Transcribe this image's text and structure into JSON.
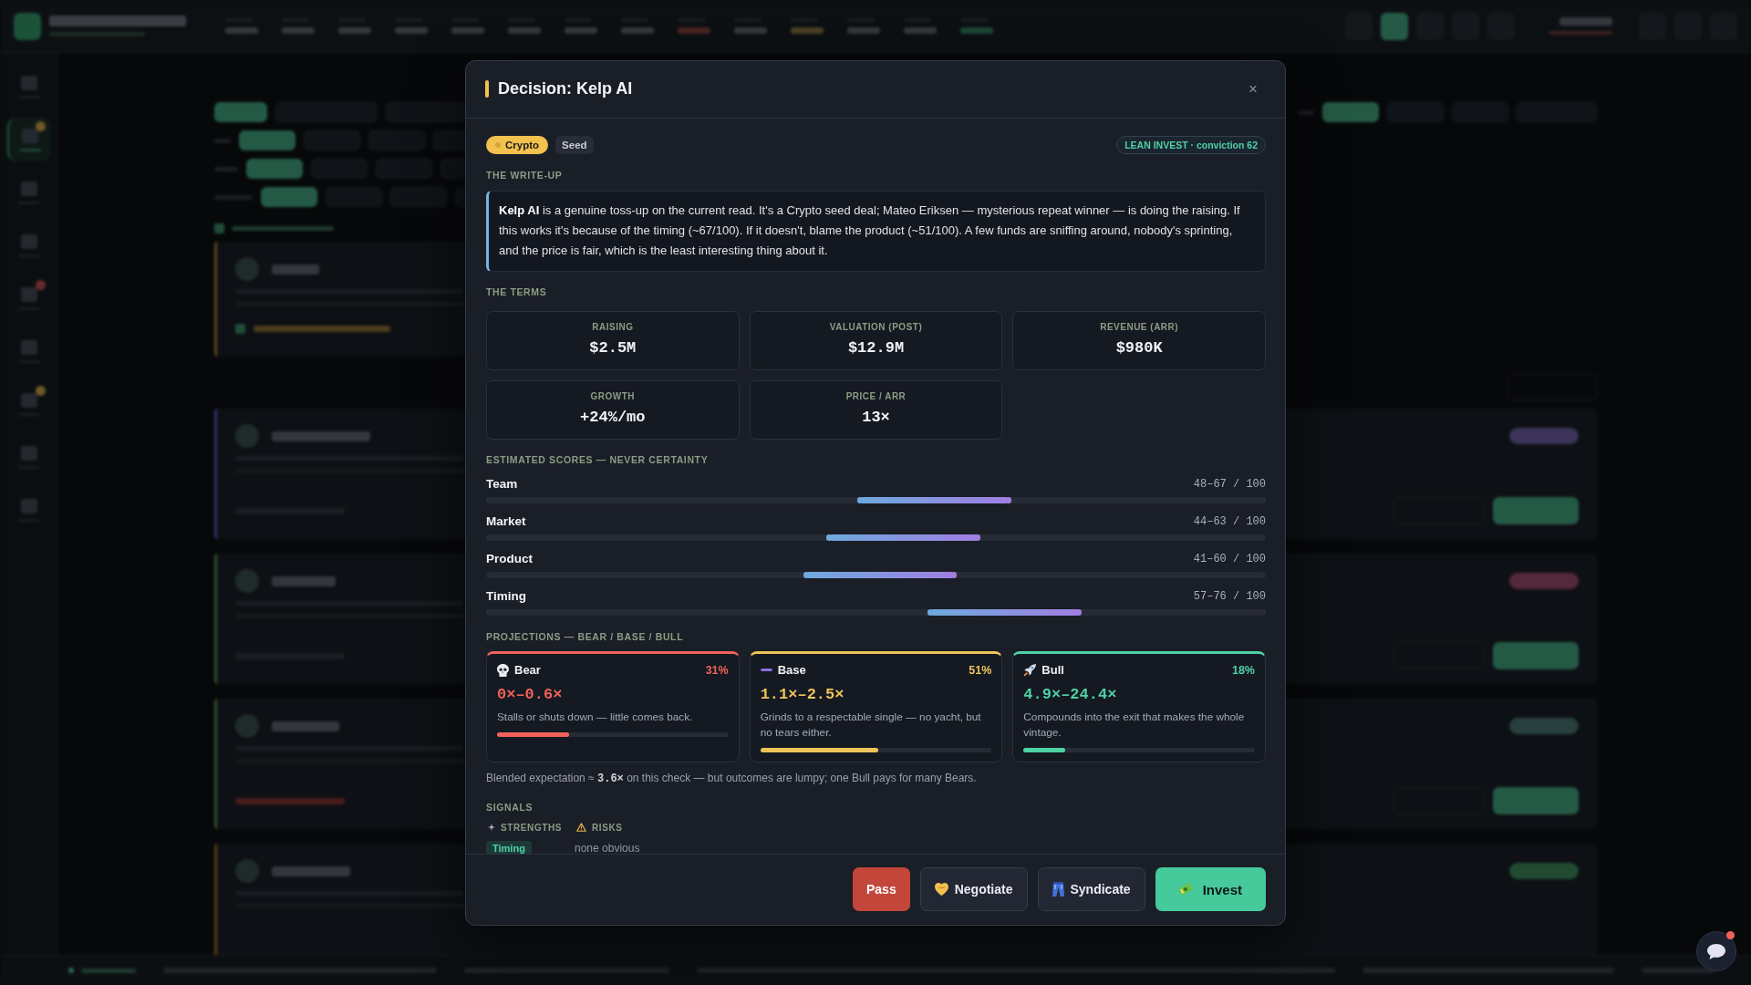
{
  "decision": {
    "title": "Decision: Kelp AI",
    "close": "×",
    "tags": [
      {
        "kind": "sector",
        "label": "Crypto"
      },
      {
        "kind": "stage",
        "label": "Seed"
      }
    ],
    "verdict": "LEAN INVEST · conviction 62",
    "writeup": {
      "heading": "THE WRITE-UP",
      "text": "**Kelp AI** is a genuine toss-up on the current read. It's a Crypto seed deal; Mateo Eriksen — mysterious repeat winner — is doing the raising. If this works it's because of the timing (~67/100). If it doesn't, blame the product (~51/100). A few funds are sniffing around, nobody's sprinting, and the price is fair, which is the least interesting thing about it."
    },
    "terms": {
      "heading": "THE TERMS",
      "items": [
        {
          "label": "RAISING",
          "value": "$2.5M"
        },
        {
          "label": "VALUATION (POST)",
          "value": "$12.9M"
        },
        {
          "label": "REVENUE (ARR)",
          "value": "$980K"
        },
        {
          "label": "GROWTH",
          "value": "+24%/mo"
        },
        {
          "label": "PRICE / ARR",
          "value": "13×"
        }
      ]
    },
    "scores": {
      "heading": "ESTIMATED SCORES — NEVER CERTAINTY",
      "items": [
        {
          "name": "Team",
          "range": "48–67 / 100",
          "low": {
            "level": 0.48
          },
          "high": {
            "level": 0.67
          }
        },
        {
          "name": "Market",
          "range": "44–63 / 100",
          "low": {
            "level": 0.44
          },
          "high": {
            "level": 0.63
          }
        },
        {
          "name": "Product",
          "range": "41–60 / 100",
          "low": {
            "level": 0.41
          },
          "high": {
            "level": 0.6
          }
        },
        {
          "name": "Timing",
          "range": "57–76 / 100",
          "low": {
            "level": 0.57
          },
          "high": {
            "level": 0.76
          }
        }
      ]
    },
    "projections": {
      "heading": "PROJECTIONS — BEAR / BASE / BULL",
      "items": [
        {
          "kind": "bear",
          "name": "Bear",
          "share": "31%",
          "multiple": "0×–0.6×",
          "description": "Stalls or shuts down — little comes back.",
          "level": 0.31,
          "color": "#f0625a"
        },
        {
          "kind": "base",
          "name": "Base",
          "share": "51%",
          "multiple": "1.1×–2.5×",
          "description": "Grinds to a respectable single — no yacht, but no tears either.",
          "level": 0.51,
          "color": "#eec35a"
        },
        {
          "kind": "bull",
          "name": "Bull",
          "share": "18%",
          "multiple": "4.9×–24.4×",
          "description": "Compounds into the exit that makes the whole vintage.",
          "level": 0.18,
          "color": "#4fd1a5"
        }
      ]
    },
    "blended": "Blended expectation ≈ **3.6×** on this check — but outcomes are lumpy; one Bull pays for many Bears.",
    "signals": {
      "heading": "SIGNALS",
      "columns": [
        {
          "kind": "strengths",
          "heading": "STRENGTHS",
          "items": [
            "Timing"
          ]
        },
        {
          "kind": "risks",
          "heading": "RISKS",
          "empty_text": "none obvious"
        }
      ]
    },
    "actions": [
      {
        "kind": "pass",
        "label": "Pass"
      },
      {
        "kind": "negotiate",
        "label": "Negotiate"
      },
      {
        "kind": "syndicate",
        "label": "Syndicate"
      },
      {
        "kind": "invest",
        "label": "Invest"
      }
    ]
  },
  "chat": {
    "unread": true
  }
}
